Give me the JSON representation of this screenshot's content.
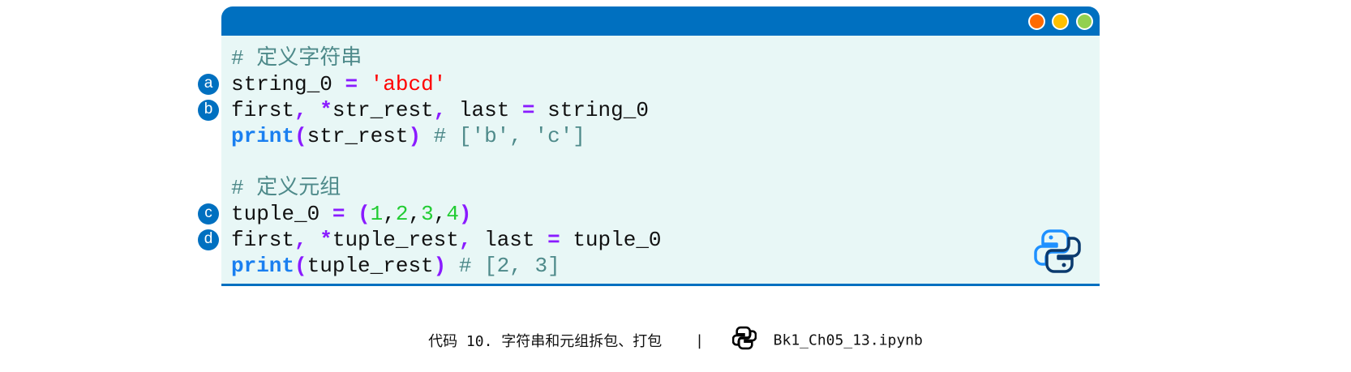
{
  "window": {
    "controls": [
      {
        "name": "close",
        "color": "#FF6A00"
      },
      {
        "name": "minimize",
        "color": "#FFC000"
      },
      {
        "name": "maximize",
        "color": "#92D050"
      }
    ],
    "accent": "#0070C0",
    "background": "#E8F7F6"
  },
  "code": {
    "lines": [
      {
        "marker": "",
        "tokens": [
          {
            "t": "# 定义字符串",
            "c": "comment"
          }
        ]
      },
      {
        "marker": "a",
        "tokens": [
          {
            "t": "string_0 ",
            "c": "plain"
          },
          {
            "t": "=",
            "c": "punc"
          },
          {
            "t": " ",
            "c": "plain"
          },
          {
            "t": "'abcd'",
            "c": "str"
          }
        ]
      },
      {
        "marker": "b",
        "tokens": [
          {
            "t": "first",
            "c": "plain"
          },
          {
            "t": ",",
            "c": "punc"
          },
          {
            "t": " ",
            "c": "plain"
          },
          {
            "t": "*",
            "c": "punc"
          },
          {
            "t": "str_rest",
            "c": "plain"
          },
          {
            "t": ",",
            "c": "punc"
          },
          {
            "t": " last ",
            "c": "plain"
          },
          {
            "t": "=",
            "c": "punc"
          },
          {
            "t": " string_0",
            "c": "plain"
          }
        ]
      },
      {
        "marker": "",
        "tokens": [
          {
            "t": "print",
            "c": "kw"
          },
          {
            "t": "(",
            "c": "punc"
          },
          {
            "t": "str_rest",
            "c": "plain"
          },
          {
            "t": ")",
            "c": "punc"
          },
          {
            "t": " # ['b', 'c']",
            "c": "comment"
          }
        ]
      },
      {
        "marker": "",
        "tokens": []
      },
      {
        "marker": "",
        "tokens": [
          {
            "t": "# 定义元组",
            "c": "comment"
          }
        ]
      },
      {
        "marker": "c",
        "tokens": [
          {
            "t": "tuple_0 ",
            "c": "plain"
          },
          {
            "t": "=",
            "c": "punc"
          },
          {
            "t": " ",
            "c": "plain"
          },
          {
            "t": "(",
            "c": "punc"
          },
          {
            "t": "1",
            "c": "num"
          },
          {
            "t": ",",
            "c": "plain"
          },
          {
            "t": "2",
            "c": "num"
          },
          {
            "t": ",",
            "c": "plain"
          },
          {
            "t": "3",
            "c": "num"
          },
          {
            "t": ",",
            "c": "plain"
          },
          {
            "t": "4",
            "c": "num"
          },
          {
            "t": ")",
            "c": "punc"
          }
        ]
      },
      {
        "marker": "d",
        "tokens": [
          {
            "t": "first",
            "c": "plain"
          },
          {
            "t": ",",
            "c": "punc"
          },
          {
            "t": " ",
            "c": "plain"
          },
          {
            "t": "*",
            "c": "punc"
          },
          {
            "t": "tuple_rest",
            "c": "plain"
          },
          {
            "t": ",",
            "c": "punc"
          },
          {
            "t": " last ",
            "c": "plain"
          },
          {
            "t": "=",
            "c": "punc"
          },
          {
            "t": " tuple_0",
            "c": "plain"
          }
        ]
      },
      {
        "marker": "",
        "tokens": [
          {
            "t": "print",
            "c": "kw"
          },
          {
            "t": "(",
            "c": "punc"
          },
          {
            "t": "tuple_rest",
            "c": "plain"
          },
          {
            "t": ")",
            "c": "punc"
          },
          {
            "t": " # [2, 3]",
            "c": "comment"
          }
        ]
      }
    ]
  },
  "corner_icon": "python-logo-icon",
  "caption": {
    "label": "代码 10. 字符串和元组拆包、打包",
    "separator": "|",
    "icon": "python-icon",
    "filename": "Bk1_Ch05_13.ipynb"
  }
}
